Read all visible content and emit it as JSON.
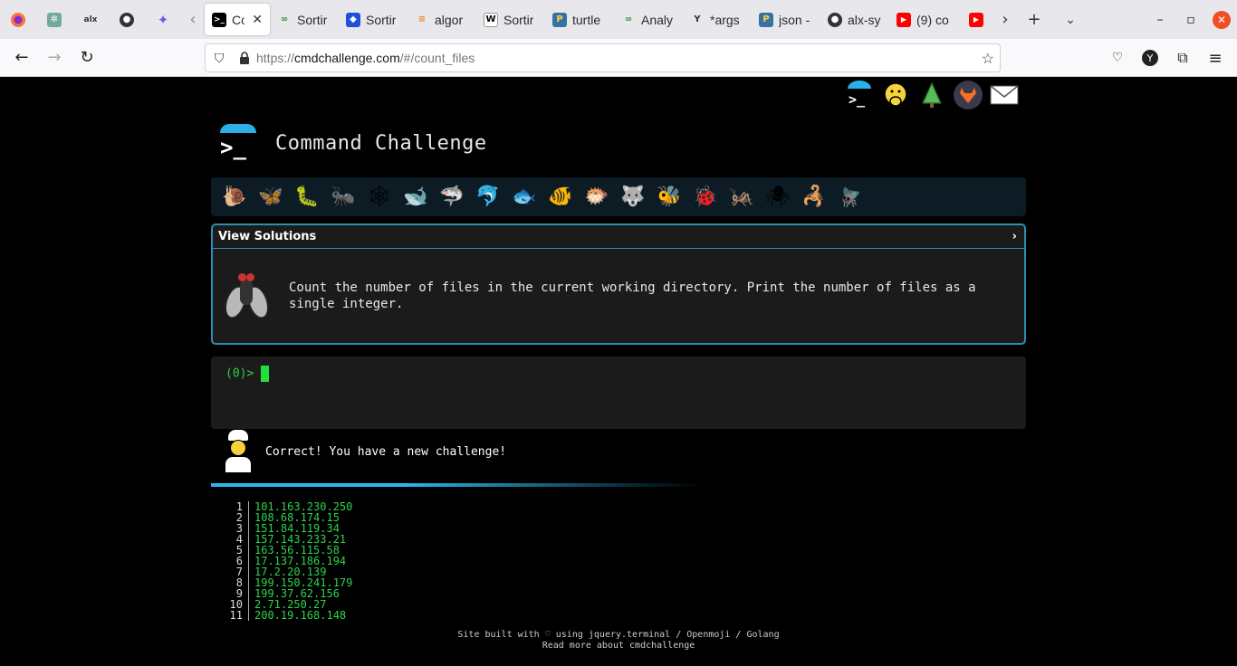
{
  "browser": {
    "tabs": [
      {
        "title": "Co",
        "icon": "terminal-favicon",
        "active": true
      },
      {
        "title": "Sortir",
        "icon": "geeks-favicon"
      },
      {
        "title": "Sortir",
        "icon": "blue-diamond-favicon"
      },
      {
        "title": "algor",
        "icon": "stackoverflow-favicon"
      },
      {
        "title": "Sortir",
        "icon": "wikipedia-favicon"
      },
      {
        "title": "turtle",
        "icon": "python-favicon"
      },
      {
        "title": "Analy",
        "icon": "geeks-favicon"
      },
      {
        "title": "*args",
        "icon": "ycombinator-favicon"
      },
      {
        "title": "json -",
        "icon": "python-favicon"
      },
      {
        "title": "alx-sy",
        "icon": "github-favicon"
      },
      {
        "title": "(9) co",
        "icon": "youtube-favicon"
      },
      {
        "title": "(",
        "icon": "youtube-favicon"
      }
    ],
    "url": {
      "protocol": "https://",
      "host": "cmdchallenge.com",
      "path": "/#/count_files"
    }
  },
  "page": {
    "title": "Command Challenge",
    "solutions_label": "View Solutions",
    "solutions_toggle": "›",
    "task": "Count the number of files in the current working directory. Print the number of files as a single integer.",
    "prompt": "(0)>",
    "status_message": "Correct! You have a new challenge!",
    "progress_fraction": 0.6,
    "listing": [
      {
        "n": "1",
        "value": "101.163.230.250"
      },
      {
        "n": "2",
        "value": "108.68.174.15"
      },
      {
        "n": "3",
        "value": "151.84.119.34"
      },
      {
        "n": "4",
        "value": "157.143.233.21"
      },
      {
        "n": "5",
        "value": "163.56.115.58"
      },
      {
        "n": "6",
        "value": "17.137.186.194"
      },
      {
        "n": "7",
        "value": "17.2.20.139"
      },
      {
        "n": "8",
        "value": "199.150.241.179"
      },
      {
        "n": "9",
        "value": "199.37.62.156"
      },
      {
        "n": "10",
        "value": "2.71.250.27"
      },
      {
        "n": "11",
        "value": "200.19.168.148"
      }
    ],
    "footer_line1": "Site built with ♡ using jquery.terminal / Openmoji / Golang",
    "footer_line2": "Read more about cmdchallenge"
  },
  "colors": {
    "accent": "#2ab0e6",
    "terminal_green": "#2dd44c",
    "page_bg": "#000000"
  }
}
